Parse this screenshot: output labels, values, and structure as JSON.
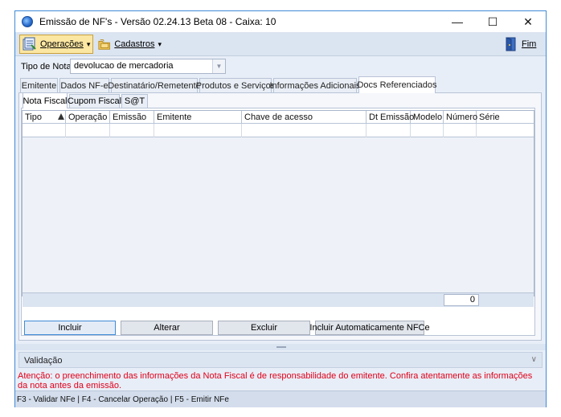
{
  "window": {
    "title": "Emissão de NF's - Versão 02.24.13 Beta 08 - Caixa: 10",
    "controls": {
      "minimize": "—",
      "maximize": "☐",
      "close": "✕"
    }
  },
  "toolbar": {
    "operacoes_label": "Operações",
    "cadastros_label": "Cadastros",
    "fim_label": "Fim",
    "dropdown_glyph": "▾"
  },
  "tipo_nota": {
    "label": "Tipo de Nota:",
    "value": "devolucao de mercadoria"
  },
  "main_tabs": [
    {
      "label": "Emitente",
      "active": false
    },
    {
      "label": "Dados NF-e",
      "active": false
    },
    {
      "label": "Destinatário/Remetente",
      "active": false
    },
    {
      "label": "Produtos e Serviços",
      "active": false
    },
    {
      "label": "Informações Adicionais",
      "active": false
    },
    {
      "label": "Docs Referenciados",
      "active": true
    }
  ],
  "sub_tabs": [
    {
      "label": "Nota Fiscal",
      "active": true
    },
    {
      "label": "Cupom Fiscal",
      "active": false
    },
    {
      "label": "S@T",
      "active": false
    }
  ],
  "grid": {
    "columns": [
      "Tipo",
      "Operação",
      "Emissão",
      "Emitente",
      "Chave de acesso",
      "Dt Emissão",
      "Modelo",
      "Número",
      "Série"
    ],
    "rows": [],
    "count": "0"
  },
  "actions": {
    "incluir": "Incluir",
    "alterar": "Alterar",
    "excluir": "Excluir",
    "incluir_auto": "Incluir Automaticamente NFCe"
  },
  "validacao": {
    "label": "Validação"
  },
  "warning": "Atenção: o preenchimento das informações da Nota Fiscal é de responsabilidade do emitente. Confira atentamente as informações da nota antes da emissão.",
  "status": "F3 - Validar NFe   | F4 - Cancelar Operação |  F5 - Emitir NFe",
  "colors": {
    "accent": "#3f8ad6",
    "warning": "#e0001a",
    "toolbar_bg": "#dbe4f1"
  }
}
